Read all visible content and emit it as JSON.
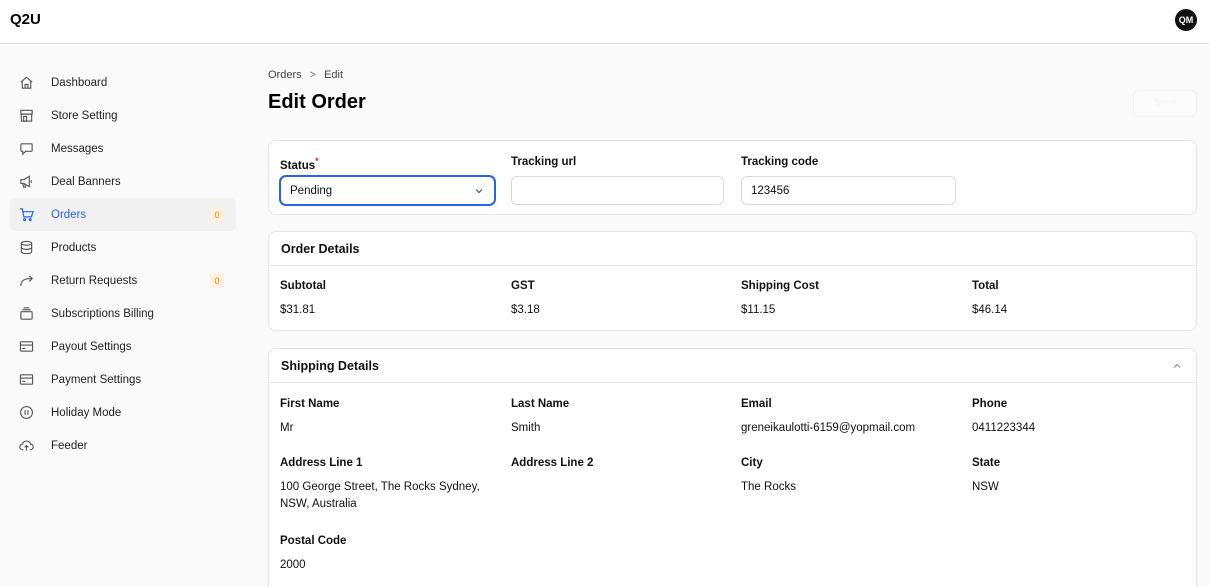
{
  "app": {
    "logo": "Q2U",
    "avatar_initials": "QM"
  },
  "sidebar": {
    "items": [
      {
        "label": "Dashboard",
        "icon": "home-icon"
      },
      {
        "label": "Store Setting",
        "icon": "store-icon"
      },
      {
        "label": "Messages",
        "icon": "chat-icon"
      },
      {
        "label": "Deal Banners",
        "icon": "megaphone-icon"
      },
      {
        "label": "Orders",
        "icon": "cart-icon",
        "badge": "0",
        "active": true
      },
      {
        "label": "Products",
        "icon": "database-icon"
      },
      {
        "label": "Return Requests",
        "icon": "return-arrow-icon",
        "badge": "0"
      },
      {
        "label": "Subscriptions Billing",
        "icon": "stack-icon"
      },
      {
        "label": "Payout Settings",
        "icon": "card-icon"
      },
      {
        "label": "Payment Settings",
        "icon": "card-icon"
      },
      {
        "label": "Holiday Mode",
        "icon": "pause-icon"
      },
      {
        "label": "Feeder",
        "icon": "cloud-upload-icon"
      }
    ]
  },
  "breadcrumb": {
    "root": "Orders",
    "separator": ">",
    "current": "Edit"
  },
  "page": {
    "title": "Edit Order",
    "action_label": "Save"
  },
  "status_form": {
    "status_label": "Status",
    "status_required": "*",
    "status_value": "Pending",
    "tracking_url_label": "Tracking url",
    "tracking_url_value": "",
    "tracking_code_label": "Tracking code",
    "tracking_code_value": "123456"
  },
  "order_details": {
    "title": "Order Details",
    "subtotal_label": "Subtotal",
    "subtotal_value": "$31.81",
    "gst_label": "GST",
    "gst_value": "$3.18",
    "shipping_label": "Shipping Cost",
    "shipping_value": "$11.15",
    "total_label": "Total",
    "total_value": "$46.14"
  },
  "shipping_details": {
    "title": "Shipping Details",
    "first_name_label": "First Name",
    "first_name_value": "Mr",
    "last_name_label": "Last Name",
    "last_name_value": "Smith",
    "email_label": "Email",
    "email_value": "greneikaulotti-6159@yopmail.com",
    "phone_label": "Phone",
    "phone_value": "0411223344",
    "address1_label": "Address Line 1",
    "address1_value_line1": "100 George Street, The Rocks Sydney,",
    "address1_value_line2": "NSW, Australia",
    "address2_label": "Address Line 2",
    "address2_value": "",
    "city_label": "City",
    "city_value": "The Rocks",
    "state_label": "State",
    "state_value": "NSW",
    "postal_label": "Postal Code",
    "postal_value": "2000"
  },
  "colors": {
    "accent": "#2563eb",
    "badge_bg": "#fdf1de",
    "badge_text": "#e08b00",
    "required": "#e11d48"
  }
}
